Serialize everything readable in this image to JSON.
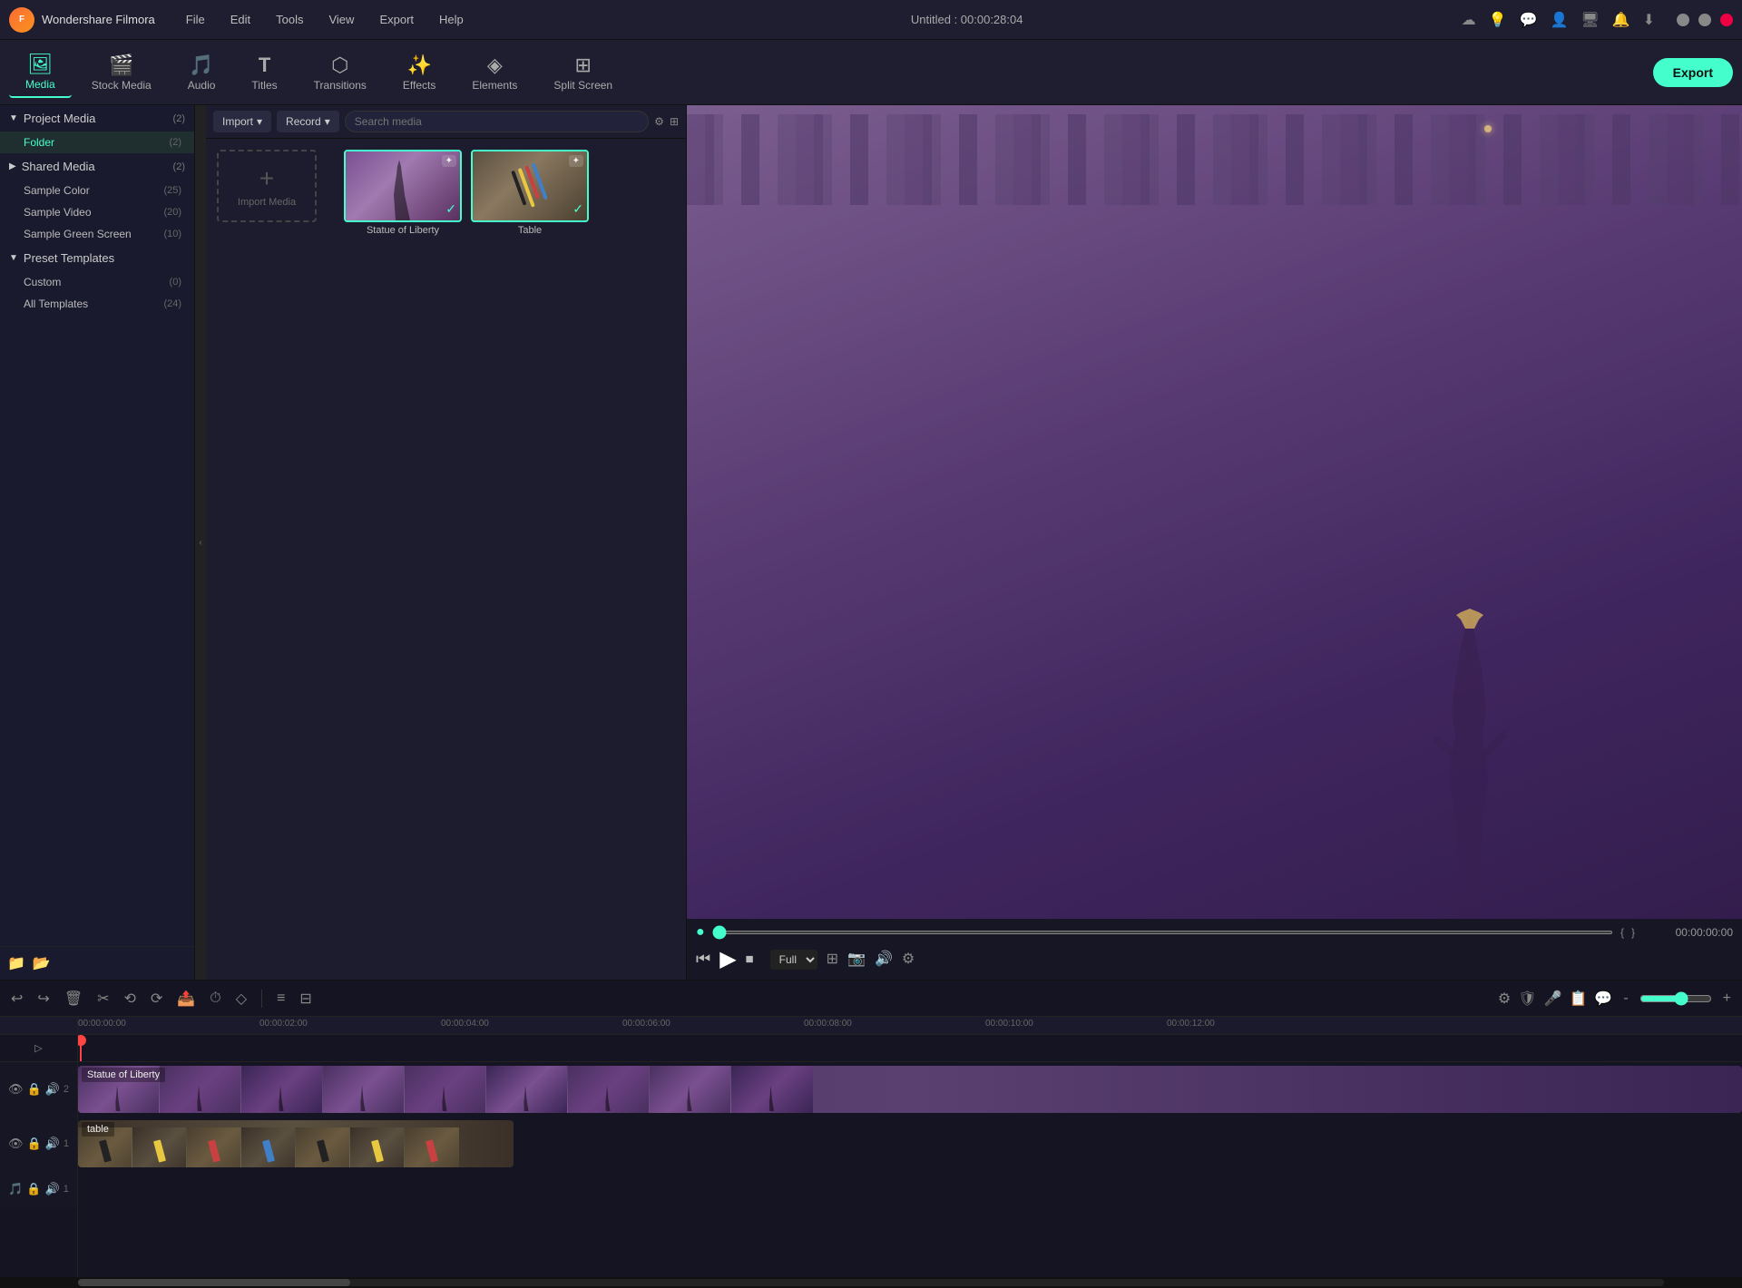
{
  "app": {
    "name": "Wondershare Filmora",
    "title": "Untitled : 00:00:28:04"
  },
  "menu": {
    "items": [
      "File",
      "Edit",
      "Tools",
      "View",
      "Export",
      "Help"
    ]
  },
  "titlebar_icons": [
    "cloud-icon",
    "bulb-icon",
    "chat-icon",
    "user-icon",
    "monitor-icon",
    "bell-icon",
    "download-icon"
  ],
  "toolbar": {
    "items": [
      {
        "id": "media",
        "label": "Media",
        "icon": "🖼"
      },
      {
        "id": "stock-media",
        "label": "Stock Media",
        "icon": "🎬"
      },
      {
        "id": "audio",
        "label": "Audio",
        "icon": "🎵"
      },
      {
        "id": "titles",
        "label": "Titles",
        "icon": "T"
      },
      {
        "id": "transitions",
        "label": "Transitions",
        "icon": "⬡"
      },
      {
        "id": "effects",
        "label": "Effects",
        "icon": "✨"
      },
      {
        "id": "elements",
        "label": "Elements",
        "icon": "◈"
      },
      {
        "id": "split-screen",
        "label": "Split Screen",
        "icon": "⊞"
      }
    ],
    "export_label": "Export"
  },
  "sidebar": {
    "sections": [
      {
        "id": "project-media",
        "label": "Project Media",
        "count": 2,
        "expanded": true,
        "children": [
          {
            "id": "folder",
            "label": "Folder",
            "count": 2
          }
        ]
      },
      {
        "id": "shared-media",
        "label": "Shared Media",
        "count": 2,
        "expanded": false,
        "children": []
      },
      {
        "id": "sample-color",
        "label": "Sample Color",
        "count": 25,
        "is_child": true
      },
      {
        "id": "sample-video",
        "label": "Sample Video",
        "count": 20,
        "is_child": true
      },
      {
        "id": "sample-green-screen",
        "label": "Sample Green Screen",
        "count": 10,
        "is_child": true
      },
      {
        "id": "preset-templates",
        "label": "Preset Templates",
        "expanded": true,
        "children": [
          {
            "id": "custom",
            "label": "Custom",
            "count": 0
          },
          {
            "id": "all-templates",
            "label": "All Templates",
            "count": 24
          }
        ]
      }
    ]
  },
  "media_toolbar": {
    "import_label": "Import",
    "record_label": "Record",
    "search_placeholder": "Search media"
  },
  "media_items": [
    {
      "id": "import",
      "type": "import",
      "label": "Import Media"
    },
    {
      "id": "statue",
      "type": "video",
      "label": "Statue of Liberty",
      "selected": true
    },
    {
      "id": "table",
      "type": "video",
      "label": "Table",
      "selected": true
    }
  ],
  "preview": {
    "time_current": "00:00:00:00",
    "quality": "Full",
    "slider_value": 0
  },
  "timeline": {
    "markers": [
      "00:00:00:00",
      "00:00:02:00",
      "00:00:04:00",
      "00:00:06:00",
      "00:00:08:00",
      "00:00:10:00",
      "00:00:12:00"
    ],
    "tracks": [
      {
        "id": "video2",
        "type": "video",
        "num": 2,
        "clip": "Statue of Liberty",
        "clip_type": "video"
      },
      {
        "id": "video1",
        "type": "video",
        "num": 1,
        "clip": "table",
        "clip_type": "overlay"
      },
      {
        "id": "audio1",
        "type": "audio",
        "num": 1,
        "clip": ""
      }
    ]
  },
  "timeline_toolbar": {
    "buttons": [
      "↩",
      "↪",
      "🗑",
      "✂",
      "⟲",
      "⟳",
      "📤",
      "⏱",
      "◇",
      "≡",
      "⊟"
    ]
  }
}
